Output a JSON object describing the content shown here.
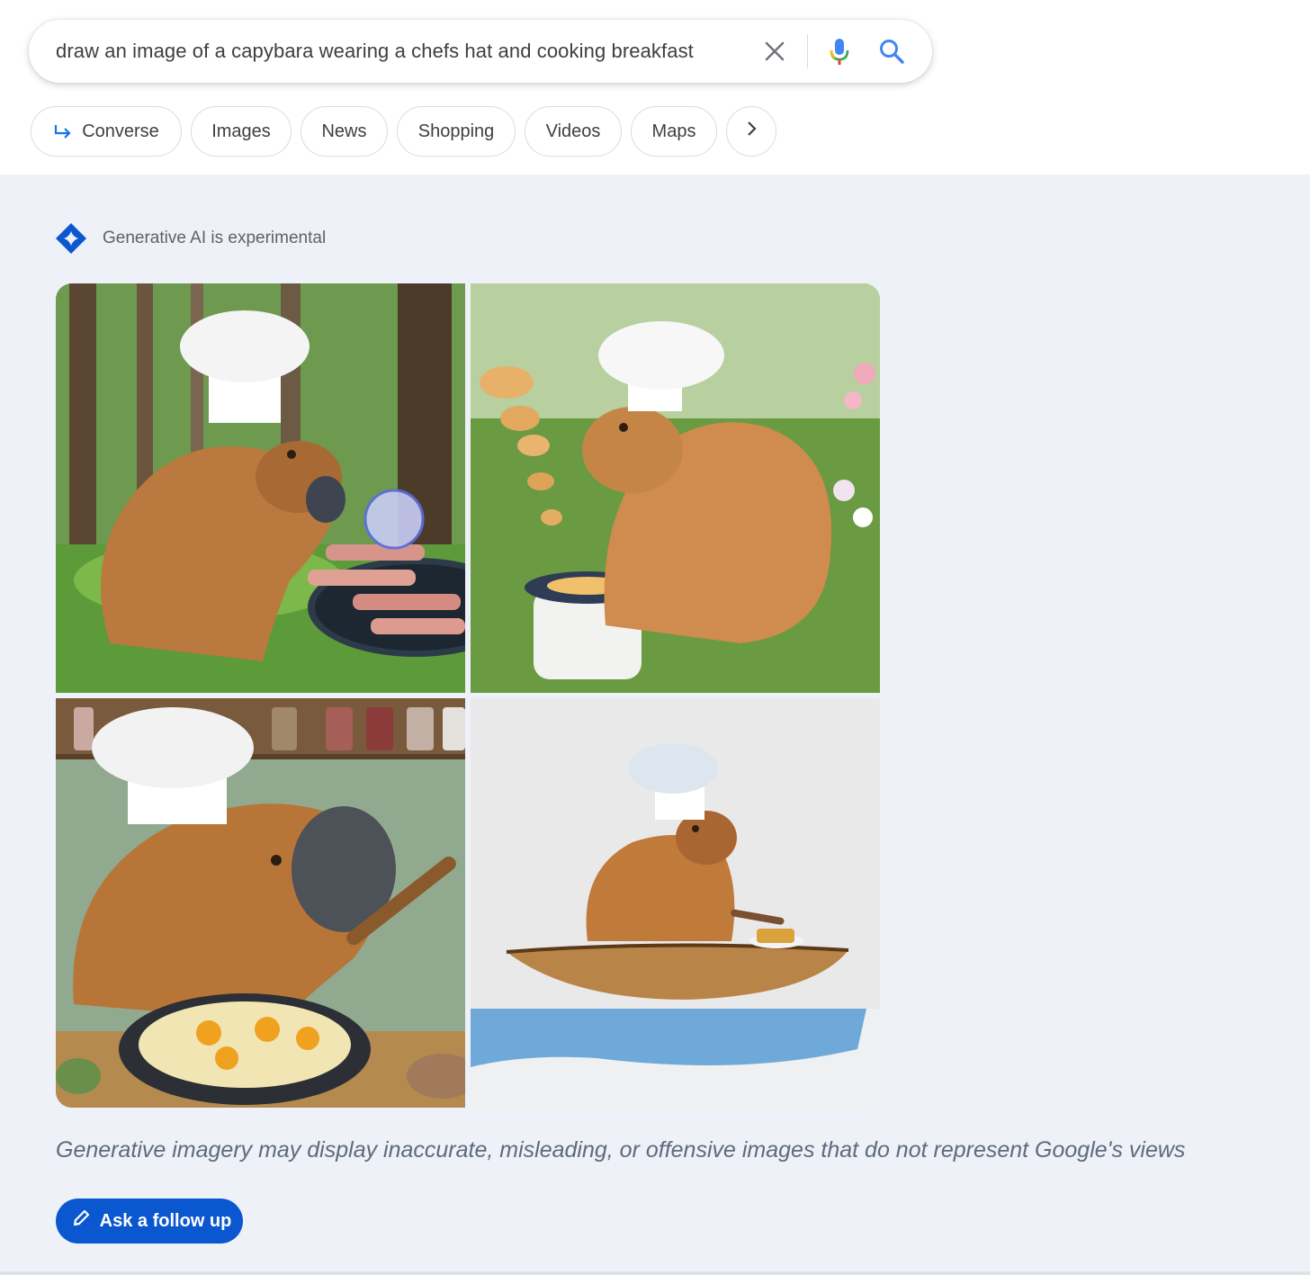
{
  "search": {
    "query": "draw an image of a capybara wearing a chefs hat and cooking breakfast"
  },
  "chips": [
    {
      "label": "Converse",
      "icon": "converse-arrow-icon"
    },
    {
      "label": "Images"
    },
    {
      "label": "News"
    },
    {
      "label": "Shopping"
    },
    {
      "label": "Videos"
    },
    {
      "label": "Maps"
    }
  ],
  "sge": {
    "badge_text": "Generative AI is experimental",
    "disclaimer": "Generative imagery may display inaccurate, misleading, or offensive images that do not represent Google's views",
    "followup_label": "Ask a follow up"
  },
  "images": [
    {
      "subject": "capybara-chef-forest-grill-bacon"
    },
    {
      "subject": "capybara-chef-garden-pancakes"
    },
    {
      "subject": "capybara-chef-kitchen-fried-eggs"
    },
    {
      "subject": "capybara-chef-canoe-toast"
    }
  ],
  "colors": {
    "accent_blue": "#1a73e8",
    "button_blue": "#0b57d0",
    "panel_bg": "#eef1f8"
  }
}
